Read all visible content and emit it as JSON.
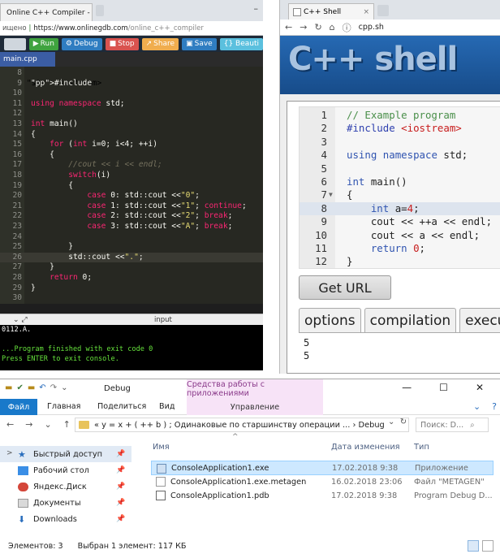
{
  "gdb": {
    "tab_title": "Online C++ Compiler - o",
    "address_left": "ищено",
    "address_host": "https://www.onlinegdb.com",
    "address_path": "/online_c++_compiler",
    "toolbar": {
      "run": "Run",
      "debug": "Debug",
      "stop": "Stop",
      "share": "Share",
      "save": "Save",
      "beautify": "{} Beauti"
    },
    "file_tab": "main.cpp",
    "code_lines": [
      {
        "n": "8",
        "t": ""
      },
      {
        "n": "9",
        "t": "#include <iostream>"
      },
      {
        "n": "10",
        "t": ""
      },
      {
        "n": "11",
        "t": "using namespace std;"
      },
      {
        "n": "12",
        "t": ""
      },
      {
        "n": "13",
        "t": "int main()"
      },
      {
        "n": "14",
        "t": "{"
      },
      {
        "n": "15",
        "t": "    for (int i=0; i<4; ++i)"
      },
      {
        "n": "16",
        "t": "    {"
      },
      {
        "n": "17",
        "t": "        //cout << i << endl;"
      },
      {
        "n": "18",
        "t": "        switch(i)"
      },
      {
        "n": "19",
        "t": "        {"
      },
      {
        "n": "20",
        "t": "            case 0: std::cout <<\"0\";"
      },
      {
        "n": "21",
        "t": "            case 1: std::cout <<\"1\"; continue;"
      },
      {
        "n": "22",
        "t": "            case 2: std::cout <<\"2\"; break;"
      },
      {
        "n": "23",
        "t": "            case 3: std::cout <<\"A\"; break;"
      },
      {
        "n": "24",
        "t": ""
      },
      {
        "n": "25",
        "t": "        }"
      },
      {
        "n": "26",
        "t": "        std::cout <<\".\";"
      },
      {
        "n": "27",
        "t": "    }"
      },
      {
        "n": "28",
        "t": "    return 0;"
      },
      {
        "n": "29",
        "t": "}"
      },
      {
        "n": "30",
        "t": ""
      }
    ],
    "io_label": "input",
    "console": [
      "0112.A.",
      "",
      "...Program finished with exit code 0",
      "Press ENTER to exit console."
    ]
  },
  "cppsh": {
    "tab_title": "C++ Shell",
    "url": "cpp.sh",
    "logo": "C++ shell",
    "code_lines": [
      {
        "n": "1",
        "t": "// Example program"
      },
      {
        "n": "2",
        "t": "#include <iostream>"
      },
      {
        "n": "3",
        "t": ""
      },
      {
        "n": "4",
        "t": "using namespace std;"
      },
      {
        "n": "5",
        "t": ""
      },
      {
        "n": "6",
        "t": "int main()"
      },
      {
        "n": "7",
        "t": "{"
      },
      {
        "n": "8",
        "t": "    int a=4;"
      },
      {
        "n": "9",
        "t": "    cout << ++a << endl;"
      },
      {
        "n": "10",
        "t": "    cout << a << endl;"
      },
      {
        "n": "11",
        "t": "    return 0;"
      },
      {
        "n": "12",
        "t": "}"
      }
    ],
    "get_url": "Get URL",
    "tabs": [
      "options",
      "compilation",
      "execu"
    ],
    "output": [
      "5",
      "5"
    ]
  },
  "explorer": {
    "title": "Debug",
    "context_group": "Средства работы с приложениями",
    "ribbon": {
      "file": "Файл",
      "home": "Главная",
      "share": "Поделиться",
      "view": "Вид",
      "manage": "Управление"
    },
    "address": "«  y = x + ( ++ b ) ; Одинаковые по старшинству операции ...  ›  Debug",
    "search_placeholder": "Поиск: D...",
    "nav": [
      {
        "label": "Быстрый доступ",
        "icon": "star-icon"
      },
      {
        "label": "Рабочий стол",
        "icon": "desktop-icon"
      },
      {
        "label": "Яндекс.Диск",
        "icon": "cloud-icon"
      },
      {
        "label": "Документы",
        "icon": "documents-icon"
      },
      {
        "label": "Downloads",
        "icon": "download-icon"
      }
    ],
    "columns": {
      "name": "Имя",
      "date": "Дата изменения",
      "type": "Тип"
    },
    "files": [
      {
        "name": "ConsoleApplication1.exe",
        "date": "17.02.2018 9:38",
        "type": "Приложение"
      },
      {
        "name": "ConsoleApplication1.exe.metagen",
        "date": "16.02.2018 23:06",
        "type": "Файл \"METAGEN\""
      },
      {
        "name": "ConsoleApplication1.pdb",
        "date": "17.02.2018 9:38",
        "type": "Program Debug D..."
      }
    ],
    "status_count": "Элементов: 3",
    "status_selected": "Выбран 1 элемент: 117 КБ"
  }
}
